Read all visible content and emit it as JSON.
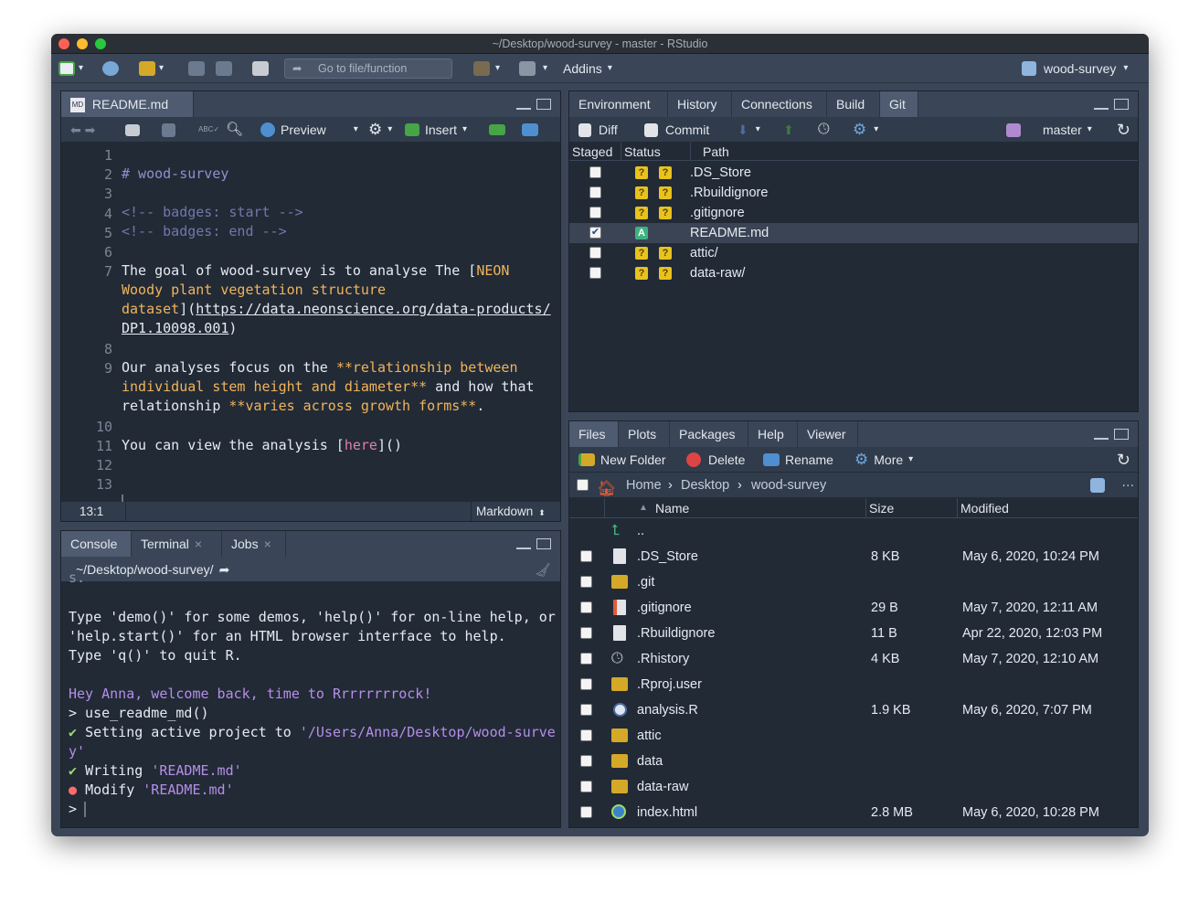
{
  "window": {
    "title": "~/Desktop/wood-survey - master - RStudio"
  },
  "toolbar": {
    "goto_placeholder": "Go to file/function",
    "addins_label": "Addins",
    "project_label": "wood-survey"
  },
  "source": {
    "tab_label": "README.md",
    "preview_label": "Preview",
    "insert_label": "Insert",
    "cursor_pos": "13:1",
    "filetype": "Markdown"
  },
  "console": {
    "tabs": [
      "Console",
      "Terminal",
      "Jobs"
    ],
    "path": "~/Desktop/wood-survey/",
    "lines": {
      "l1": "Type 'demo()' for some demos, 'help()' for on-line help, or",
      "l2": "'help.start()' for an HTML browser interface to help.",
      "l3": "Type 'q()' to quit R.",
      "l4": "Hey Anna, welcome back, time to Rrrrrrrrock!",
      "l5": "> use_readme_md()",
      "l6a": "Setting active project to ",
      "l6b": "'/Users/Anna/Desktop/wood-surve",
      "l6c": "y'",
      "l7a": "Writing ",
      "l7b": "'README.md'",
      "l8a": "Modify ",
      "l8b": "'README.md'",
      "l9": ">"
    }
  },
  "envpane": {
    "tabs": [
      "Environment",
      "History",
      "Connections",
      "Build",
      "Git"
    ],
    "diff_label": "Diff",
    "commit_label": "Commit",
    "branch_label": "master",
    "headers": {
      "staged": "Staged",
      "status": "Status",
      "path": "Path"
    },
    "files": [
      {
        "path": ".DS_Store",
        "staged": false,
        "status": "?"
      },
      {
        "path": ".Rbuildignore",
        "staged": false,
        "status": "?"
      },
      {
        "path": ".gitignore",
        "staged": false,
        "status": "?"
      },
      {
        "path": "README.md",
        "staged": true,
        "status": "A"
      },
      {
        "path": "attic/",
        "staged": false,
        "status": "?"
      },
      {
        "path": "data-raw/",
        "staged": false,
        "status": "?"
      }
    ]
  },
  "filespane": {
    "tabs": [
      "Files",
      "Plots",
      "Packages",
      "Help",
      "Viewer"
    ],
    "new_folder_label": "New Folder",
    "delete_label": "Delete",
    "rename_label": "Rename",
    "more_label": "More",
    "breadcrumb": [
      "Home",
      "Desktop",
      "wood-survey"
    ],
    "headers": {
      "name": "Name",
      "size": "Size",
      "modified": "Modified"
    },
    "up_label": "..",
    "files": [
      {
        "name": ".DS_Store",
        "size": "8 KB",
        "modified": "May 6, 2020, 10:24 PM",
        "icon": "doc-icon"
      },
      {
        "name": ".git",
        "size": "",
        "modified": "",
        "icon": "folder-icon"
      },
      {
        "name": ".gitignore",
        "size": "29 B",
        "modified": "May 7, 2020, 12:11 AM",
        "icon": "gitignore-icon"
      },
      {
        "name": ".Rbuildignore",
        "size": "11 B",
        "modified": "Apr 22, 2020, 12:03 PM",
        "icon": "doc-icon"
      },
      {
        "name": ".Rhistory",
        "size": "4 KB",
        "modified": "May 7, 2020, 12:10 AM",
        "icon": "history-icon"
      },
      {
        "name": ".Rproj.user",
        "size": "",
        "modified": "",
        "icon": "folder-icon"
      },
      {
        "name": "analysis.R",
        "size": "1.9 KB",
        "modified": "May 6, 2020, 7:07 PM",
        "icon": "r-file-icon"
      },
      {
        "name": "attic",
        "size": "",
        "modified": "",
        "icon": "folder-icon"
      },
      {
        "name": "data",
        "size": "",
        "modified": "",
        "icon": "folder-icon"
      },
      {
        "name": "data-raw",
        "size": "",
        "modified": "",
        "icon": "folder-icon"
      },
      {
        "name": "index.html",
        "size": "2.8 MB",
        "modified": "May 6, 2020, 10:28 PM",
        "icon": "html-icon"
      }
    ]
  },
  "editor": {
    "line_numbers": [
      "1",
      "2",
      "3",
      "4",
      "5",
      "6",
      "7",
      "",
      "",
      "",
      "8",
      "9",
      "",
      "",
      "10",
      "11",
      "12",
      "13"
    ],
    "l2": "# wood-survey",
    "l4": "<!-- badges: start -->",
    "l5": "<!-- badges: end -->",
    "l7a": "The goal of wood-survey is to analyse The [",
    "l7b": "NEON",
    "l7c": "Woody plant vegetation structure",
    "l7d": "dataset",
    "l7e": "](",
    "l7f": "https://data.neonscience.org/data-products/",
    "l7g": "DP1.10098.001",
    "l7h": ")",
    "l9a": "Our analyses focus on the ",
    "l9b": "**relationship between",
    "l9c": "individual stem height and diameter**",
    "l9d": " and how that",
    "l9e": "relationship ",
    "l9f": "**varies across growth forms**",
    "l9g": ".",
    "l11a": "You can view the analysis [",
    "l11b": "here",
    "l11c": "]()"
  }
}
